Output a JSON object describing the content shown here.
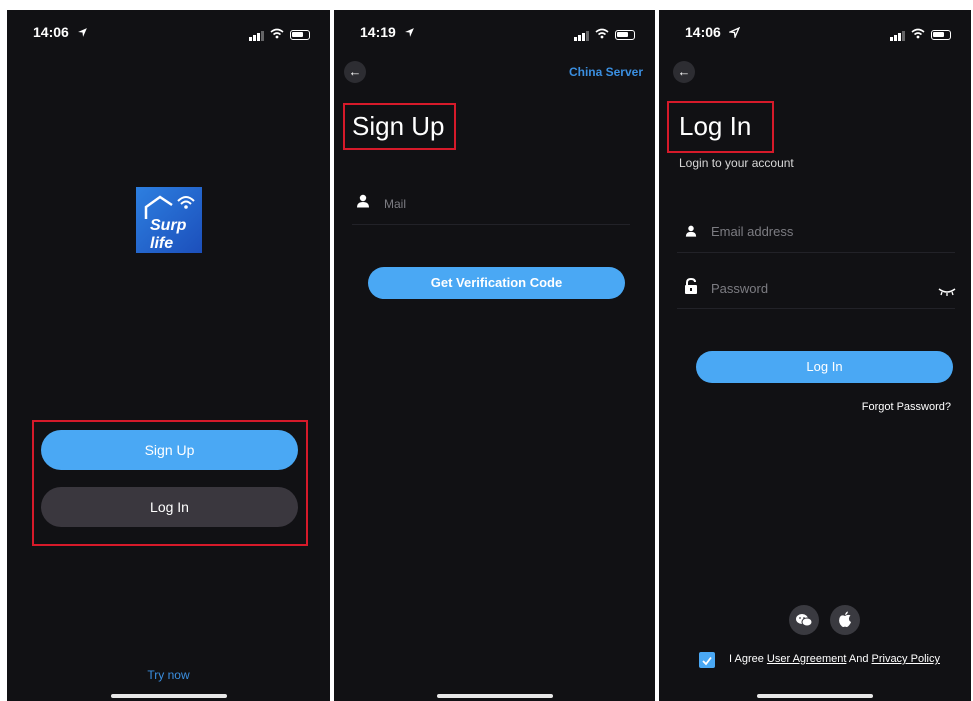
{
  "status": {
    "p1_time": "14:06",
    "p2_time": "14:19",
    "p3_time": "14:06"
  },
  "welcome": {
    "logo_text": "Surp life",
    "signup_label": "Sign Up",
    "login_label": "Log In",
    "try_now": "Try now"
  },
  "signup": {
    "server_label": "China Server",
    "title": "Sign Up",
    "mail_placeholder": "Mail",
    "verify_button": "Get Verification Code"
  },
  "login": {
    "title": "Log In",
    "subtitle": "Login to your account",
    "email_placeholder": "Email address",
    "password_placeholder": "Password",
    "login_button": "Log In",
    "forgot": "Forgot Password?",
    "agree_prefix": "I Agree",
    "user_agreement": "User Agreement",
    "and": "And",
    "privacy_policy": "Privacy Policy"
  },
  "icons": {
    "location": "location-arrow-icon",
    "signal": "signal-bars-icon",
    "wifi": "wifi-icon",
    "battery": "battery-icon",
    "back": "back-arrow-icon",
    "user": "user-icon",
    "lock": "lock-icon",
    "eye_closed": "eye-closed-icon",
    "wechat": "wechat-icon",
    "apple": "apple-icon",
    "checkbox": "checkbox-checked-icon"
  },
  "colors": {
    "background": "#111114",
    "accent_blue": "#4aa8f4",
    "dark_button": "#3a373e",
    "link_blue": "#3b8fe0",
    "highlight_red": "#d61a2a"
  }
}
